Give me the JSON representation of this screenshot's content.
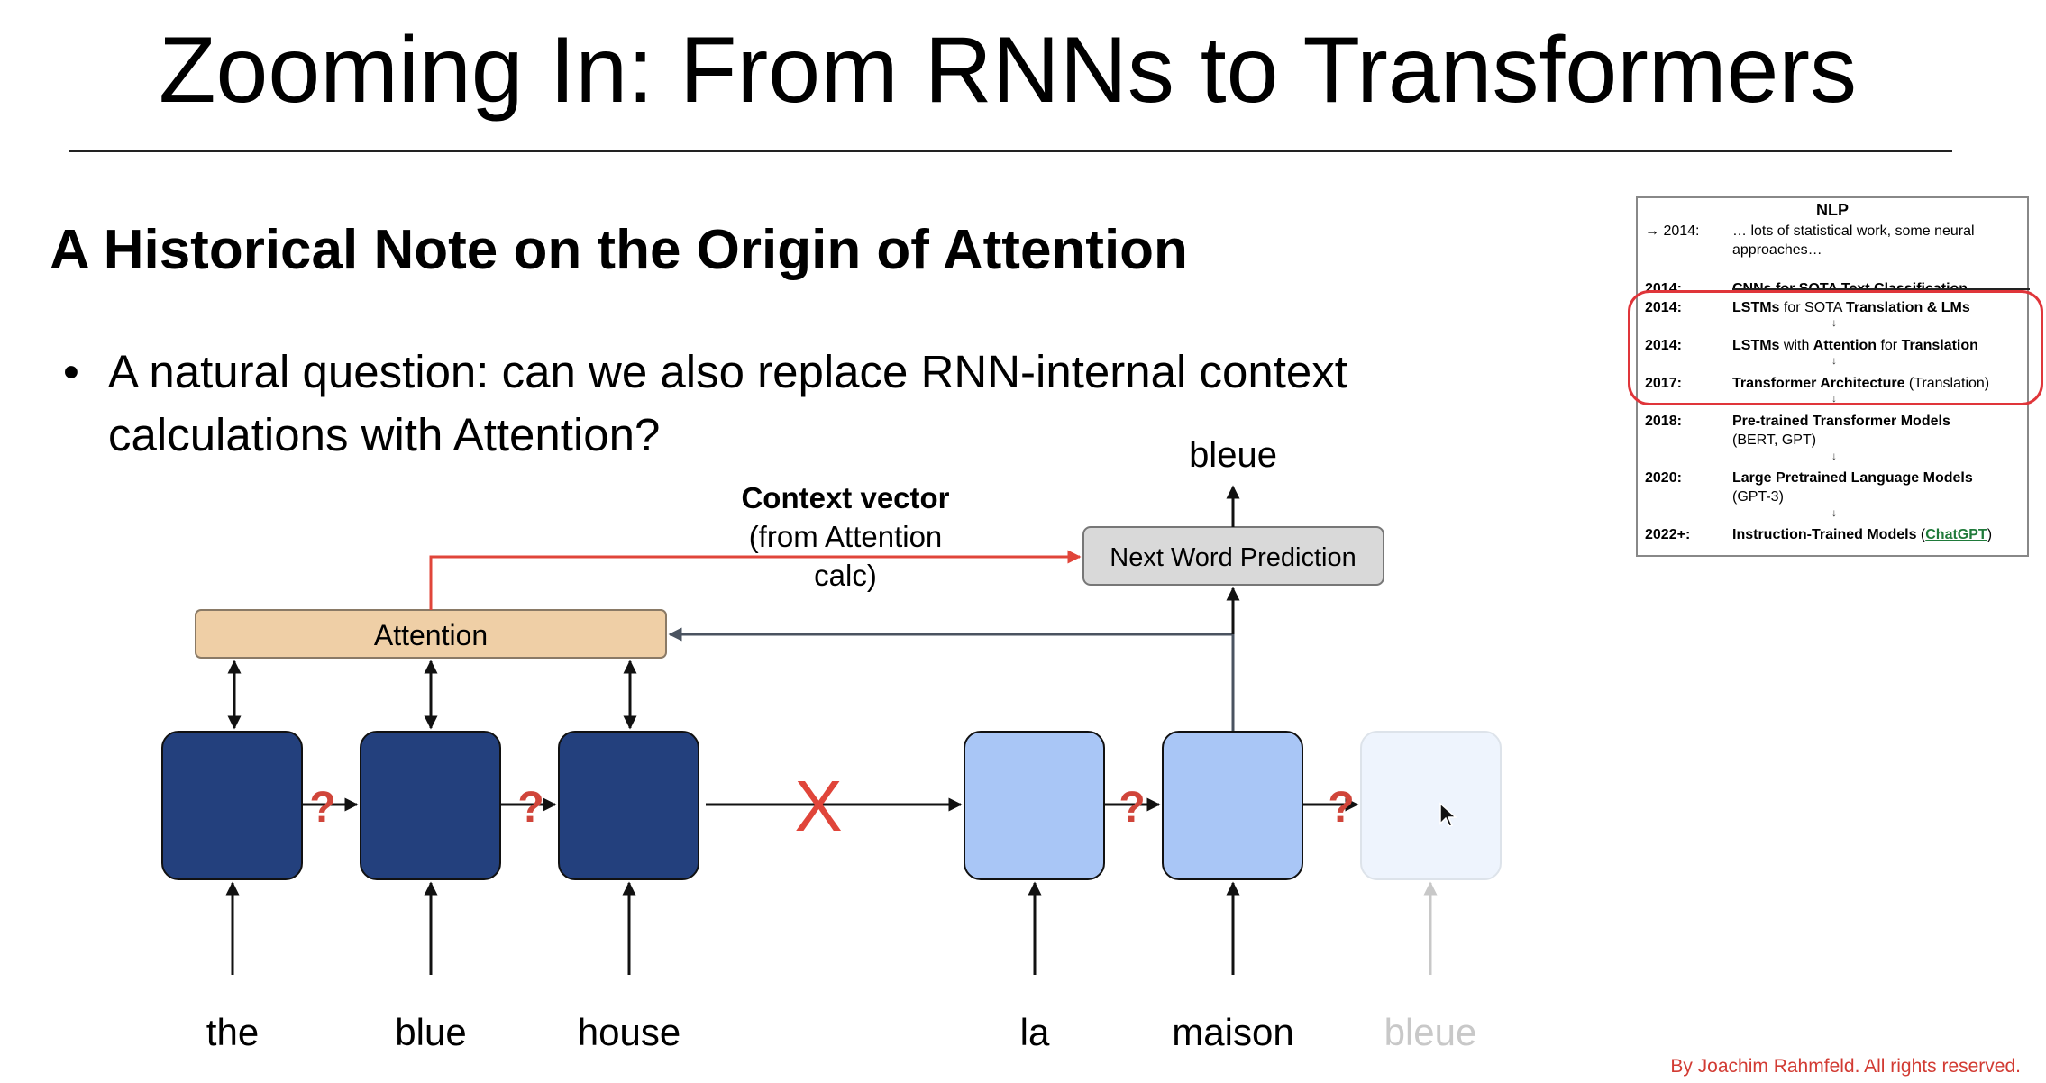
{
  "slide": {
    "title": "Zooming In: From RNNs to Transformers",
    "subtitle": "A Historical Note on the Origin of Attention",
    "bullet": "A natural question: can we also replace RNN-internal context calculations with Attention?",
    "copyright": "By Joachim Rahmfeld. All rights reserved."
  },
  "diagram": {
    "attention_label": "Attention",
    "context_vector_title": "Context vector",
    "context_vector_sub1": "(from Attention",
    "context_vector_sub2": "calc)",
    "next_word_label": "Next Word Prediction",
    "output_word": "bleue",
    "question_mark": "?",
    "cross_mark": "X",
    "encoder_words": [
      "the",
      "blue",
      "house"
    ],
    "decoder_words": [
      "la",
      "maison",
      "bleue"
    ],
    "colors": {
      "encoder_cell": "#23407d",
      "decoder_cell": "#a9c6f6",
      "decoder_cell_faded": "#eef4fd",
      "attention_fill": "#efcfa6",
      "prediction_fill": "#d9d9d9",
      "red": "#e0453a"
    }
  },
  "nlp_timeline": {
    "title": "NLP",
    "rows": [
      {
        "year": "→ 2014:",
        "text_plain": "… lots of statistical work, some neural",
        "text_plain2": "approaches…"
      },
      {
        "year": "2014:",
        "text": "CNNs for SOTA Text Classification"
      },
      {
        "year": "2014:",
        "text_b1": "LSTMs",
        "text_m": " for SOTA ",
        "text_b2": "Translation & LMs"
      },
      {
        "year": "2014:",
        "text_b1": "LSTMs",
        "text_m": " with ",
        "text_b2": "Attention",
        "text_m2": " for ",
        "text_b3": "Translation"
      },
      {
        "year": "2017:",
        "text_b1": "Transformer Architecture",
        "text_m": " (Translation)"
      },
      {
        "year": "2018:",
        "text_b1": "Pre-trained Transformer Models",
        "text_m": "(BERT, GPT)"
      },
      {
        "year": "2020:",
        "text_b1": "Large Pretrained Language Models",
        "text_m": "(GPT-3)"
      },
      {
        "year": "2022+:",
        "text_b1": "Instruction-Trained Models",
        "text_m": " (",
        "link": "ChatGPT",
        "text_m2": ")"
      }
    ],
    "arrow": "↓"
  }
}
